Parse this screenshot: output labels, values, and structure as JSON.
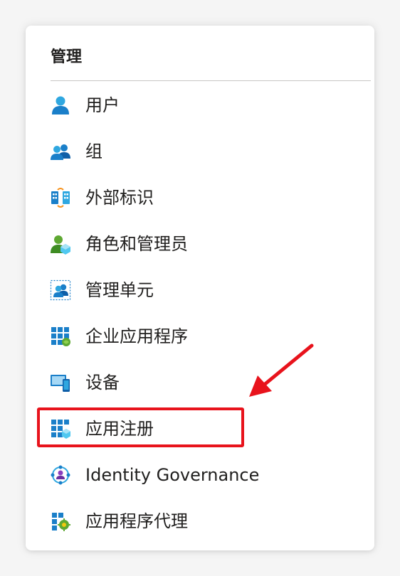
{
  "section": {
    "title": "管理"
  },
  "menu": {
    "items": [
      {
        "label": "用户",
        "icon": "user-icon"
      },
      {
        "label": "组",
        "icon": "group-icon"
      },
      {
        "label": "外部标识",
        "icon": "external-identities-icon"
      },
      {
        "label": "角色和管理员",
        "icon": "roles-admins-icon"
      },
      {
        "label": "管理单元",
        "icon": "admin-units-icon"
      },
      {
        "label": "企业应用程序",
        "icon": "enterprise-apps-icon"
      },
      {
        "label": "设备",
        "icon": "devices-icon"
      },
      {
        "label": "应用注册",
        "icon": "app-registrations-icon"
      },
      {
        "label": "Identity Governance",
        "icon": "identity-governance-icon"
      },
      {
        "label": "应用程序代理",
        "icon": "app-proxy-icon"
      }
    ]
  },
  "annotation": {
    "highlighted_item": "应用注册",
    "highlight_color": "#e8131c"
  },
  "colors": {
    "accent_blue": "#0078d4",
    "text": "#201f1e"
  }
}
